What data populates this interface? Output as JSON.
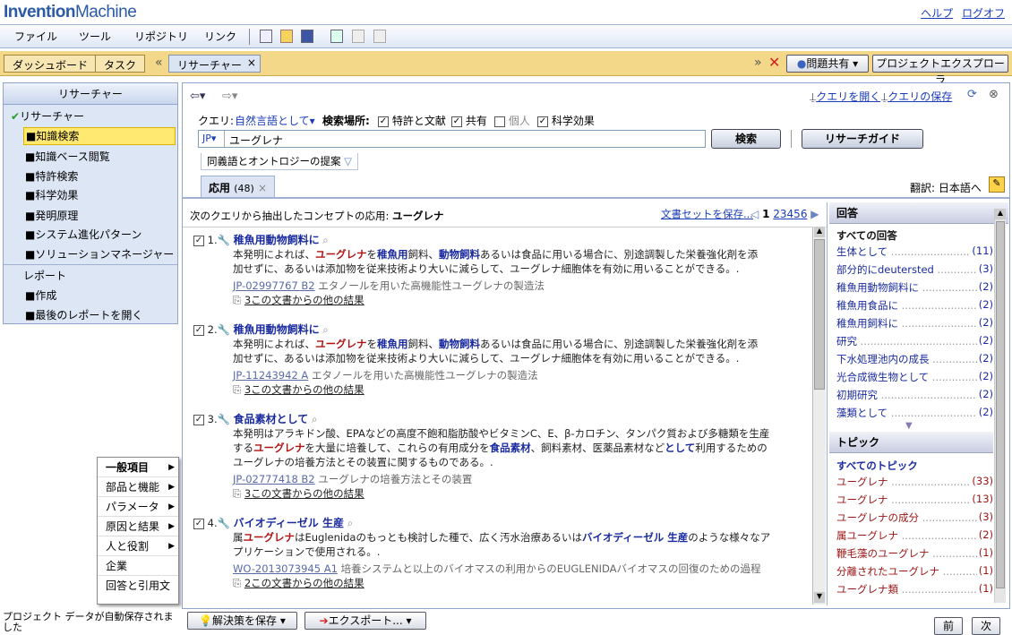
{
  "logo": {
    "a": "Invention",
    "b": "Machine"
  },
  "toplinks": {
    "help": "ヘルプ",
    "logout": "ログオフ"
  },
  "menu": [
    "ファイル",
    "ツール",
    "リポジトリ",
    "リンク"
  ],
  "tabs": {
    "dashboard": "ダッシュボード",
    "task": "タスク",
    "researcher": "リサーチャー",
    "close": "×",
    "nav": "«"
  },
  "rightbar": {
    "problem": "問題共有",
    "explorer": "プロジェクトエクスプローラ",
    "nav": "»"
  },
  "left": {
    "head": "リサーチャー",
    "root": "リサーチャー",
    "items": [
      "■知識検索",
      "■知識ベース閲覧",
      "■特許検索",
      "■科学効果",
      "■発明原理",
      "■システム進化パターン",
      "■ソリューションマネージャー"
    ],
    "report": "レポート",
    "report_items": [
      "■作成",
      "■最後のレポートを開く"
    ]
  },
  "ctx": [
    "一般項目",
    "部品と機能",
    "パラメータ",
    "原因と結果",
    "人と役割",
    "企業",
    "回答と引用文"
  ],
  "status": "プロジェクト データが自動保存されました",
  "subbar": {
    "open_query": "クエリを開く",
    "save_query": "クエリの保存"
  },
  "query": {
    "label": "クエリ:",
    "mode": "自然言語として",
    "scope": "検索場所:",
    "opt1": "特許と文献",
    "opt2": "共有",
    "opt3": "個人",
    "opt4": "科学効果",
    "lang": "JP",
    "value": "ユーグレナ",
    "search": "検索",
    "guide": "リサーチガイド",
    "suggest": "同義語とオントロジーの提案"
  },
  "restab": {
    "label": "応用",
    "count": "(48)",
    "close": "×"
  },
  "translate": "翻訳: 日本語へ",
  "results_head": {
    "prefix": "次のクエリから抽出したコンセプトの応用:",
    "term": "ユーグレナ",
    "save": "文書セットを保存...",
    "pages": [
      "1",
      "2",
      "3",
      "4",
      "5",
      "6"
    ]
  },
  "results": [
    {
      "num": "1.",
      "title": "稚魚用動物飼料に",
      "l1": "本発明によれば、",
      "hl1": "ユーグレナ",
      "l1b": "を",
      "bl1": "稚魚用",
      "l1c": "飼料、",
      "bl2": "動物飼料",
      "l1d": "あるいは食品に用いる場合に、別途調製した栄養強化剤を添",
      "l2": "加せずに、あるいは添加物を従来技術より大いに減らして、ユーグレナ細胞体を有効に用いることができる。.",
      "id": "JP-02997767 B2",
      "doc": "エタノールを用いた高機能性ユーグレナの製造法",
      "more": "3この文書からの他の結果"
    },
    {
      "num": "2.",
      "title": "稚魚用動物飼料に",
      "l1": "本発明によれば、",
      "hl1": "ユーグレナ",
      "l1b": "を",
      "bl1": "稚魚用",
      "l1c": "飼料、",
      "bl2": "動物飼料",
      "l1d": "あるいは食品に用いる場合に、別途調製した栄養強化剤を添",
      "l2": "加せずに、あるいは添加物を従来技術より大いに減らして、ユーグレナ細胞体を有効に用いることができる。.",
      "id": "JP-11243942 A",
      "doc": "エタノールを用いた高機能性ユーグレナの製造法",
      "more": "3この文書からの他の結果"
    },
    {
      "num": "3.",
      "title": "食品素材として",
      "l1": "本発明はアラキドン酸、EPAなどの高度不飽和脂肪酸やビタミンC、E、β-カロチン、タンパク質および多糖類を生産",
      "l2a": "する",
      "hl": "ユーグレナ",
      "l2b": "を大量に培養して、これらの有用成分を",
      "bl": "食品素材",
      "l2c": "、飼料素材、医薬品素材など",
      "bl2": "として",
      "l2d": "利用するための",
      "l3": "ユーグレナの培養方法とその装置に関するものである。.",
      "id": "JP-02777418 B2",
      "doc": "ユーグレナの培養方法とその装置",
      "more": "3この文書からの他の結果"
    },
    {
      "num": "4.",
      "title": "バイオディーゼル 生産",
      "l1a": "属",
      "hl": "ユーグレナ",
      "l1b": "はEuglenidaのもっとも検討した種で、広く汚水治療あるいは",
      "bl": "バイオディーゼル 生産",
      "l1c": "のような様々なア",
      "l2": "プリケーションで使用される。.",
      "id": "WO-2013073945 A1",
      "doc": "培養システムと以上のバイオマスの利用からのEUGLENIDAバイオマスの回復のための過程",
      "more": "2この文書からの他の結果"
    }
  ],
  "answers": {
    "head": "回答",
    "all": "すべての回答",
    "items": [
      [
        "生体として",
        "(11)"
      ],
      [
        "部分的にdeutersted",
        "(3)"
      ],
      [
        "稚魚用動物飼料に",
        "(2)"
      ],
      [
        "稚魚用食品に",
        "(2)"
      ],
      [
        "稚魚用飼料に",
        "(2)"
      ],
      [
        "研究",
        "(2)"
      ],
      [
        "下水処理池内の成長",
        "(2)"
      ],
      [
        "光合成微生物として",
        "(2)"
      ],
      [
        "初期研究",
        "(2)"
      ],
      [
        "藻類として",
        "(2)"
      ]
    ]
  },
  "topics": {
    "head": "トピック",
    "all": "すべてのトピック",
    "items": [
      [
        "ユーグレナ",
        "(33)"
      ],
      [
        "ユーグレナ",
        "(13)"
      ],
      [
        "ユーグレナの成分",
        "(3)"
      ],
      [
        "属ユーグレナ",
        "(2)"
      ],
      [
        "鞭毛藻のユーグレナ",
        "(1)"
      ],
      [
        "分離されたユーグレナ",
        "(1)"
      ],
      [
        "ユーグレナ類",
        "(1)"
      ]
    ]
  },
  "bottom": {
    "save_solution": "解決策を保存",
    "export": "エクスポート...",
    "prev": "前",
    "next": "次"
  }
}
